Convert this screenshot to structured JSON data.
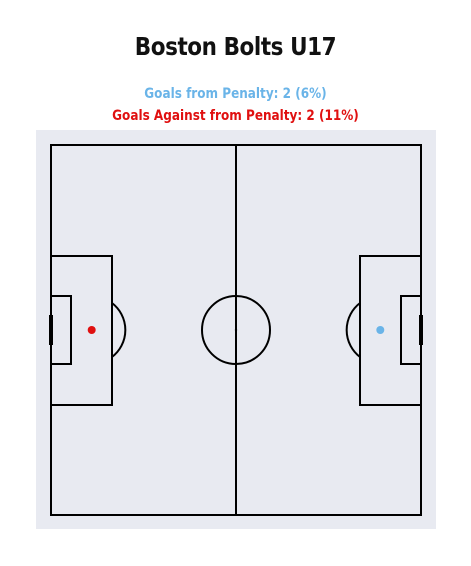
{
  "title": "Boston Bolts U17",
  "subtitle_for": "Goals from Penalty: 2 (6%)",
  "subtitle_against": "Goals Against from Penalty: 2 (11%)",
  "colors": {
    "for": "#6ab4e8",
    "against": "#e01010",
    "background": "#e8eaf1",
    "lines": "#000000"
  },
  "chart_data": {
    "type": "scatter",
    "title": "Boston Bolts U17",
    "series": [
      {
        "name": "Goals from Penalty: 2 (6%)",
        "color": "#6ab4e8",
        "points": [
          {
            "x": 89,
            "y": 50
          }
        ]
      },
      {
        "name": "Goals Against from Penalty: 2 (11%)",
        "color": "#e01010",
        "points": [
          {
            "x": 11,
            "y": 50
          }
        ]
      }
    ],
    "xlim": [
      0,
      100
    ],
    "ylim": [
      0,
      100
    ],
    "grid": false
  }
}
